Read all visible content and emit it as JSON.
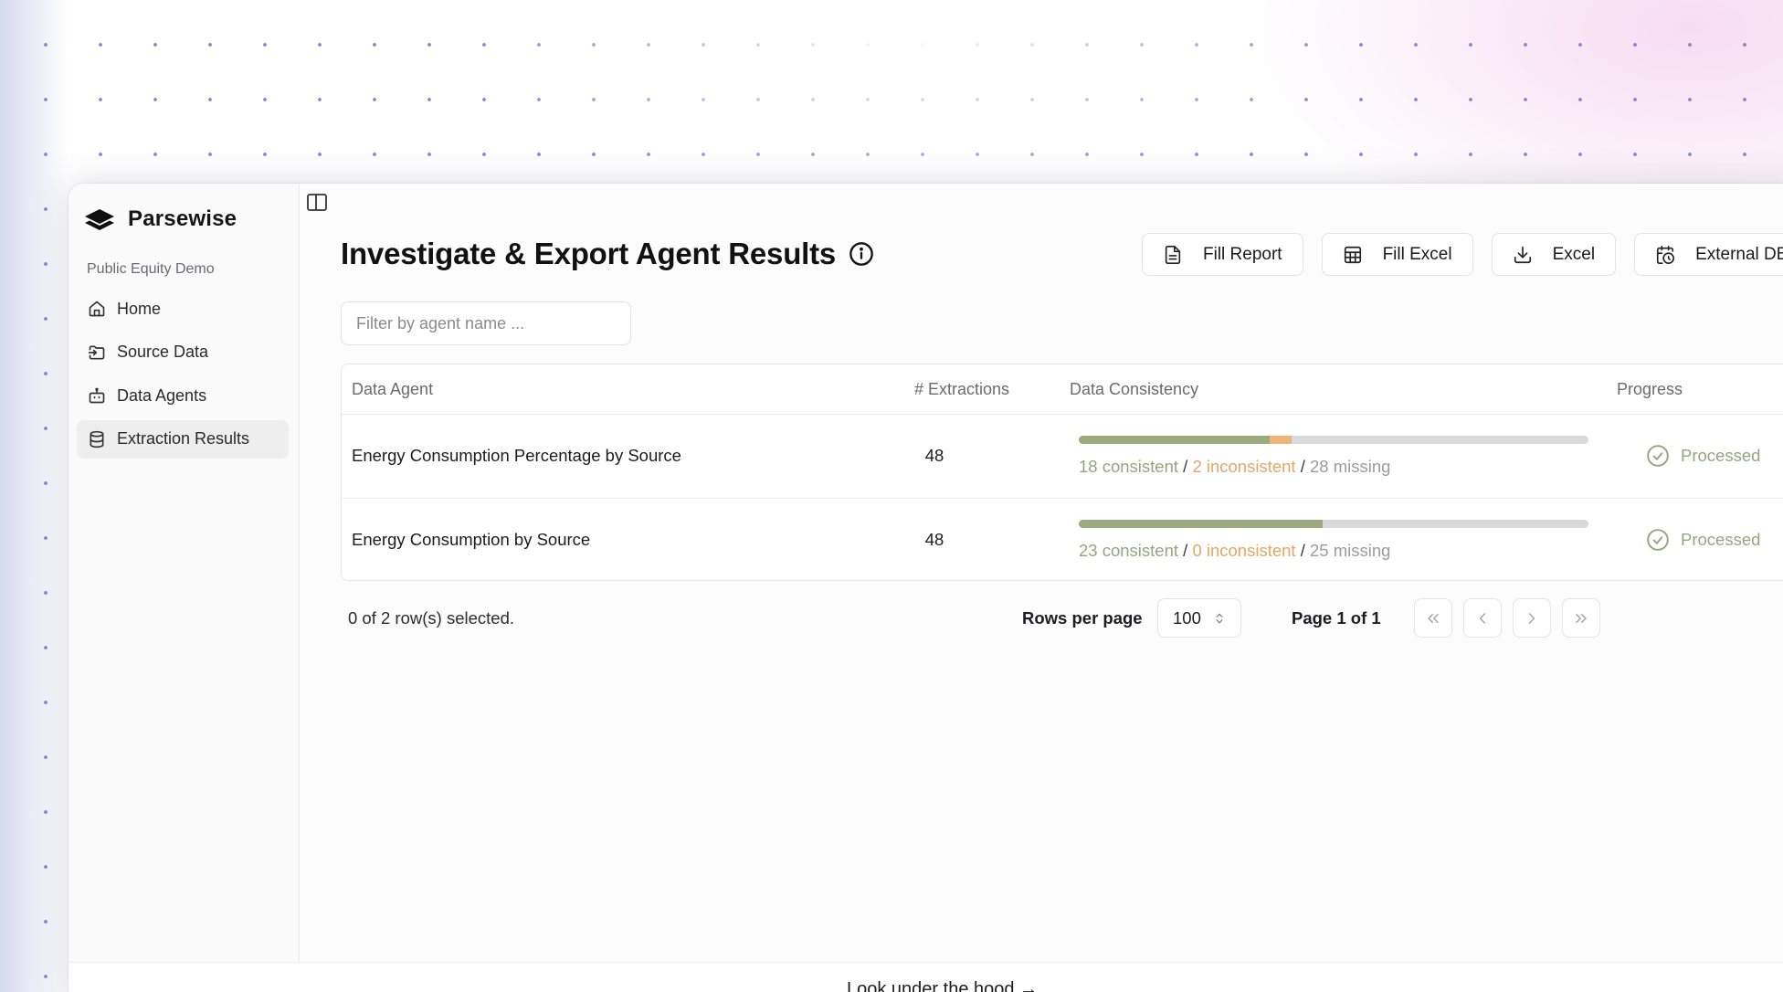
{
  "brand": {
    "name": "Parsewise"
  },
  "sidebar": {
    "workspace": "Public Equity Demo",
    "items": [
      {
        "label": "Home",
        "icon": "home-icon"
      },
      {
        "label": "Source Data",
        "icon": "folder-input-icon"
      },
      {
        "label": "Data Agents",
        "icon": "bot-icon"
      },
      {
        "label": "Extraction Results",
        "icon": "database-icon",
        "active": true
      }
    ]
  },
  "header": {
    "title": "Investigate & Export Agent Results"
  },
  "toolbar": {
    "fill_report": "Fill Report",
    "fill_excel": "Fill Excel",
    "excel": "Excel",
    "external_db": "External DB"
  },
  "filter": {
    "placeholder": "Filter by agent name ..."
  },
  "table": {
    "columns": {
      "agent": "Data Agent",
      "extractions": "# Extractions",
      "consistency": "Data Consistency",
      "progress": "Progress"
    },
    "rows": [
      {
        "agent": "Energy Consumption Percentage by Source",
        "extractions": "48",
        "consistent": 18,
        "inconsistent": 2,
        "missing": 28,
        "consistent_text": "18 consistent",
        "inconsistent_text": "2 inconsistent",
        "missing_text": "28 missing",
        "status": "Processed"
      },
      {
        "agent": "Energy Consumption by Source",
        "extractions": "48",
        "consistent": 23,
        "inconsistent": 0,
        "missing": 25,
        "consistent_text": "23 consistent",
        "inconsistent_text": "0 inconsistent",
        "missing_text": "25 missing",
        "status": "Processed"
      }
    ]
  },
  "pagination": {
    "selected": "0 of 2 row(s) selected.",
    "rows_per_page_label": "Rows per page",
    "rows_per_page": "100",
    "page": "Page 1 of 1"
  },
  "bottom": {
    "link": "Look under the hood →"
  },
  "colors": {
    "consistent": "#9bab7f",
    "inconsistent": "#efb477",
    "missing": "#d9d9db",
    "processed": "#95a67e"
  }
}
